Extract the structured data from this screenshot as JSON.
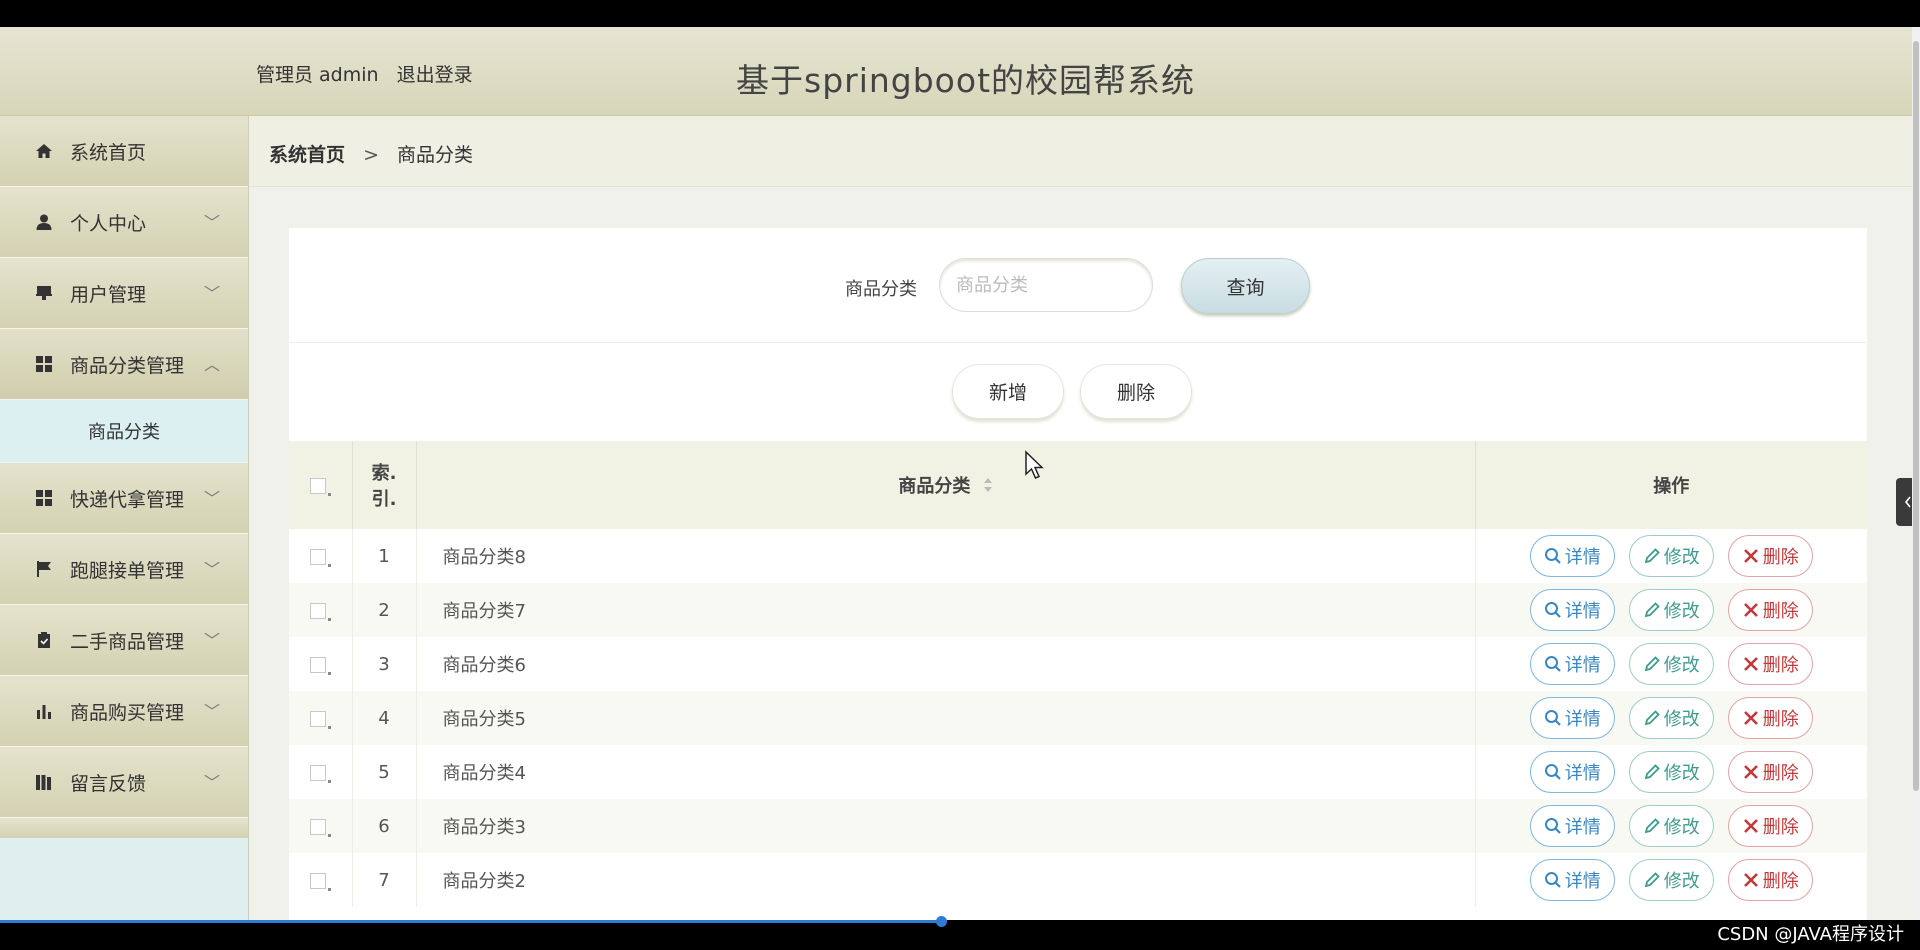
{
  "header": {
    "admin_role": "管理员 admin",
    "logout": "退出登录",
    "title": "基于springboot的校园帮系统"
  },
  "sidebar": {
    "items": [
      {
        "label": "系统首页",
        "icon": "home-icon"
      },
      {
        "label": "个人中心",
        "icon": "user-icon"
      },
      {
        "label": "用户管理",
        "icon": "stamp-icon"
      },
      {
        "label": "商品分类管理",
        "icon": "grid-icon"
      },
      {
        "label": "快递代拿管理",
        "icon": "grid-icon"
      },
      {
        "label": "跑腿接单管理",
        "icon": "flag-icon"
      },
      {
        "label": "二手商品管理",
        "icon": "clipboard-icon"
      },
      {
        "label": "商品购买管理",
        "icon": "bar-chart-icon"
      },
      {
        "label": "留言反馈",
        "icon": "book-icon"
      }
    ],
    "sub_item": "商品分类"
  },
  "breadcrumb": {
    "home": "系统首页",
    "separator": ">",
    "current": "商品分类"
  },
  "search": {
    "label": "商品分类",
    "placeholder": "商品分类",
    "query_button": "查询"
  },
  "actions": {
    "add_button": "新增",
    "delete_button": "删除"
  },
  "table": {
    "headers": {
      "index_line1": "索.",
      "index_line2": "引.",
      "name": "商品分类",
      "operations": "操作"
    },
    "rows": [
      {
        "index": "1",
        "name": "商品分类8"
      },
      {
        "index": "2",
        "name": "商品分类7"
      },
      {
        "index": "3",
        "name": "商品分类6"
      },
      {
        "index": "4",
        "name": "商品分类5"
      },
      {
        "index": "5",
        "name": "商品分类4"
      },
      {
        "index": "6",
        "name": "商品分类3"
      },
      {
        "index": "7",
        "name": "商品分类2"
      }
    ],
    "op_labels": {
      "detail": "详情",
      "edit": "修改",
      "delete": "删除"
    }
  },
  "watermark": "CSDN @JAVA程序设计",
  "colors": {
    "header_bg": "#d7d6b9",
    "sidebar_active": "#dceff1",
    "detail": "#3a86c2",
    "edit": "#3e9b8f",
    "delete": "#c0393b"
  },
  "video_progress": 0.49
}
